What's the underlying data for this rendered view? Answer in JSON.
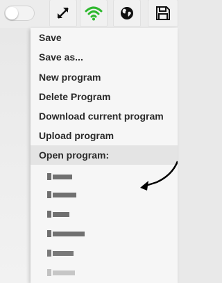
{
  "toolbar": {
    "toggle_state": "off",
    "icons": [
      "expand-icon",
      "wifi-icon",
      "globe-icon",
      "save-icon"
    ],
    "wifi_color": "#2eb82e"
  },
  "menu": {
    "items": [
      {
        "label": "Save"
      },
      {
        "label": "Save  as..."
      },
      {
        "label": "New program"
      },
      {
        "label": "Delete Program"
      },
      {
        "label": "Download current program"
      },
      {
        "label": "Upload program"
      },
      {
        "label": "Open program:"
      }
    ],
    "highlighted_item": "Open program:",
    "program_list_placeholder_count": 6
  },
  "annotation": {
    "type": "curved-arrow",
    "color": "#000000"
  }
}
